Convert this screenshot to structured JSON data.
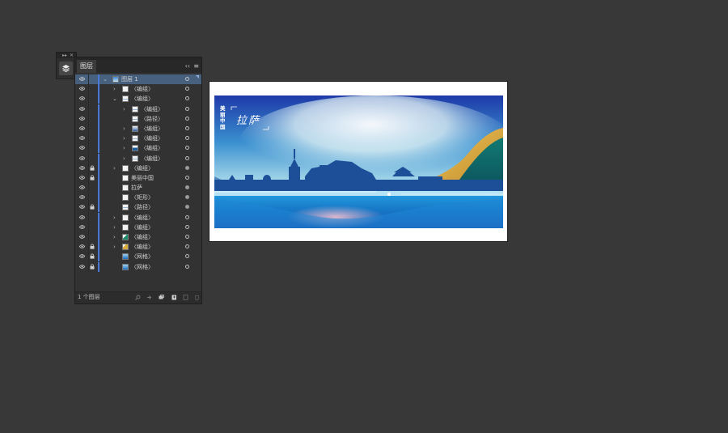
{
  "dock": {
    "icon": "layers-icon"
  },
  "panel": {
    "tab_label": "图层",
    "collapse_icon": "double-chevron-left-icon",
    "menu_icon": "hamburger-menu-icon",
    "footer_count": "1 个图层",
    "footer_icons": [
      "search-icon",
      "collect-export-icon",
      "make-clipping-mask-icon",
      "new-sublayer-icon",
      "new-layer-icon",
      "delete-icon"
    ],
    "layers": [
      {
        "label": "图层 1",
        "indent": 0,
        "expander": "down",
        "selected": true,
        "locked": false,
        "thumb": "art",
        "target": "ring"
      },
      {
        "label": "〈编组〉",
        "indent": 1,
        "expander": "right",
        "locked": false,
        "thumb": "blank",
        "target": "ring"
      },
      {
        "label": "〈编组〉",
        "indent": 1,
        "expander": "down",
        "locked": false,
        "thumb": "line",
        "target": "ring"
      },
      {
        "label": "〈编组〉",
        "indent": 2,
        "expander": "right",
        "locked": false,
        "thumb": "line",
        "target": "ring"
      },
      {
        "label": "〈路径〉",
        "indent": 2,
        "expander": "",
        "locked": false,
        "thumb": "line",
        "target": "ring"
      },
      {
        "label": "〈编组〉",
        "indent": 2,
        "expander": "right",
        "locked": false,
        "thumb": "tower",
        "target": "ring"
      },
      {
        "label": "〈编组〉",
        "indent": 2,
        "expander": "right",
        "locked": false,
        "thumb": "line",
        "target": "ring"
      },
      {
        "label": "〈编组〉",
        "indent": 2,
        "expander": "right",
        "locked": false,
        "thumb": "mount",
        "target": "ring"
      },
      {
        "label": "〈编组〉",
        "indent": 2,
        "expander": "right",
        "locked": false,
        "thumb": "line",
        "target": "ring"
      },
      {
        "label": "〈编组〉",
        "indent": 1,
        "expander": "right",
        "locked": true,
        "thumb": "blank",
        "target": "dot"
      },
      {
        "label": "美丽中国",
        "indent": 1,
        "expander": "",
        "locked": true,
        "thumb": "blank",
        "target": "ring"
      },
      {
        "label": "拉萨",
        "indent": 1,
        "expander": "",
        "locked": false,
        "thumb": "blank",
        "target": "dot"
      },
      {
        "label": "〈矩形〉",
        "indent": 1,
        "expander": "",
        "locked": false,
        "thumb": "blank",
        "target": "dot"
      },
      {
        "label": "〈路径〉",
        "indent": 1,
        "expander": "",
        "locked": true,
        "thumb": "line",
        "target": "dot"
      },
      {
        "label": "〈编组〉",
        "indent": 1,
        "expander": "right",
        "locked": false,
        "thumb": "blank",
        "target": "ring"
      },
      {
        "label": "〈编组〉",
        "indent": 1,
        "expander": "right",
        "locked": false,
        "thumb": "blank",
        "target": "ring"
      },
      {
        "label": "〈编组〉",
        "indent": 1,
        "expander": "right",
        "locked": false,
        "thumb": "green",
        "target": "ring"
      },
      {
        "label": "〈编组〉",
        "indent": 1,
        "expander": "right",
        "locked": true,
        "thumb": "gold",
        "target": "ring"
      },
      {
        "label": "〈网格〉",
        "indent": 1,
        "expander": "",
        "locked": true,
        "thumb": "mesh",
        "target": "ring"
      },
      {
        "label": "〈网格〉",
        "indent": 1,
        "expander": "",
        "locked": true,
        "thumb": "mesh",
        "target": "ring"
      }
    ]
  },
  "artwork": {
    "vertical_title": "美丽中国",
    "calligraphy_title": "拉萨",
    "colors": {
      "sky_top": "#1a3fa8",
      "sky_glow": "#e6f6f6",
      "water": "#1778c8",
      "gold": "#d8a83c",
      "teal": "#0f6e6e",
      "silhouette": "#1a4f96"
    }
  }
}
